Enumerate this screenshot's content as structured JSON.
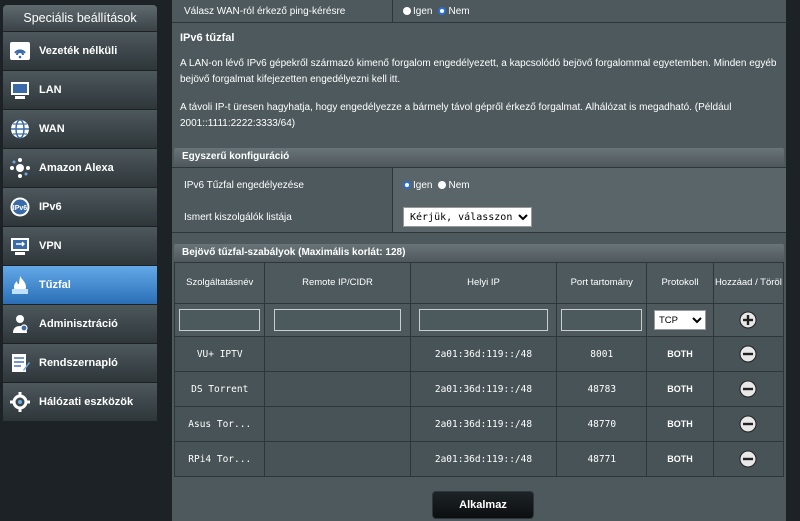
{
  "sidebar": {
    "title": "Speciális beállítások",
    "items": [
      {
        "label": "Vezeték nélküli",
        "icon": "wifi-icon"
      },
      {
        "label": "LAN",
        "icon": "lan-icon"
      },
      {
        "label": "WAN",
        "icon": "globe-icon"
      },
      {
        "label": "Amazon Alexa",
        "icon": "alexa-icon"
      },
      {
        "label": "IPv6",
        "icon": "ipv6-icon"
      },
      {
        "label": "VPN",
        "icon": "vpn-icon"
      },
      {
        "label": "Tűzfal",
        "icon": "firewall-icon",
        "active": true
      },
      {
        "label": "Adminisztráció",
        "icon": "admin-icon"
      },
      {
        "label": "Rendszernapló",
        "icon": "log-icon"
      },
      {
        "label": "Hálózati eszközök",
        "icon": "tools-icon"
      }
    ]
  },
  "wan_ping": {
    "label": "Válasz WAN-ról érkező ping-kérésre",
    "opt_yes": "Igen",
    "opt_no": "Nem",
    "selected": "Nem"
  },
  "ipv6": {
    "title": "IPv6 tűzfal",
    "para1": "A LAN-on lévő IPv6 gépekről származó kimenő forgalom engedélyezett, a kapcsolódó bejövő forgalommal egyetemben. Minden egyéb bejövő forgalmat kifejezetten engedélyezni kell itt.",
    "para2": "A távoli IP-t üresen hagyhatja, hogy engedélyezze a bármely távol gépről érkező forgalmat. Alhálózat is megadható. (Például 2001::1111:2222:3333/64)"
  },
  "simple_config": {
    "header": "Egyszerű konfiguráció",
    "enable_label": "IPv6 Tűzfal engedélyezése",
    "opt_yes": "Igen",
    "opt_no": "Nem",
    "selected": "Igen",
    "servers_label": "Ismert kiszolgálók listája",
    "servers_value": "Kérjük, válasszon"
  },
  "rules": {
    "header": "Bejövő tűzfal-szabályok (Maximális korlát: 128)",
    "columns": [
      "Szolgáltatásnév",
      "Remote IP/CIDR",
      "Helyi IP",
      "Port tartomány",
      "Protokoll",
      "Hozzáad / Töröl"
    ],
    "protocol_default": "TCP",
    "rows": [
      {
        "name": "VU+ IPTV",
        "remote": "",
        "local": "2a01:36d:119::/48",
        "port": "8001",
        "proto": "BOTH"
      },
      {
        "name": "DS Torrent",
        "remote": "",
        "local": "2a01:36d:119::/48",
        "port": "48783",
        "proto": "BOTH"
      },
      {
        "name": "Asus Tor...",
        "remote": "",
        "local": "2a01:36d:119::/48",
        "port": "48770",
        "proto": "BOTH"
      },
      {
        "name": "RPi4 Tor...",
        "remote": "",
        "local": "2a01:36d:119::/48",
        "port": "48771",
        "proto": "BOTH"
      }
    ]
  },
  "apply_label": "Alkalmaz"
}
